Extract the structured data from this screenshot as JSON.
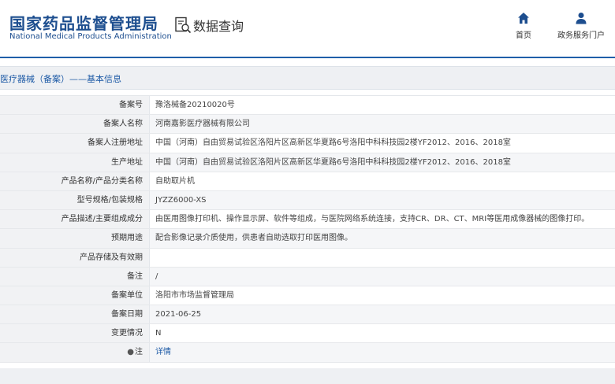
{
  "header": {
    "logo_cn": "国家药品监督管理局",
    "logo_en": "National Medical Products Administration",
    "query_label": "数据查询",
    "nav": [
      {
        "label": "首页",
        "icon": "home-icon"
      },
      {
        "label": "政务服务门户",
        "icon": "user-icon"
      }
    ]
  },
  "breadcrumb": "医疗器械（备案）——基本信息",
  "rows": [
    {
      "label": "备案号",
      "value": "豫洛械备20210020号"
    },
    {
      "label": "备案人名称",
      "value": "河南嘉影医疗器械有限公司"
    },
    {
      "label": "备案人注册地址",
      "value": "中国（河南）自由贸易试验区洛阳片区高新区华夏路6号洛阳中科科技园2楼YF2012、2016、2018室"
    },
    {
      "label": "生产地址",
      "value": "中国（河南）自由贸易试验区洛阳片区高新区华夏路6号洛阳中科科技园2楼YF2012、2016、2018室"
    },
    {
      "label": "产品名称/产品分类名称",
      "value": "自助取片机"
    },
    {
      "label": "型号规格/包装规格",
      "value": "JYZZ6000-XS"
    },
    {
      "label": "产品描述/主要组成成分",
      "value": "由医用图像打印机、操作显示屏、软件等组成，与医院网络系统连接，支持CR、DR、CT、MRI等医用成像器械的图像打印。"
    },
    {
      "label": "预期用途",
      "value": "配合影像记录介质使用，供患者自助选取打印医用图像。"
    },
    {
      "label": "产品存储及有效期",
      "value": ""
    },
    {
      "label": "备注",
      "value": "/"
    },
    {
      "label": "备案单位",
      "value": "洛阳市市场监督管理局"
    },
    {
      "label": "备案日期",
      "value": "2021-06-25"
    },
    {
      "label": "变更情况",
      "value": "N"
    }
  ],
  "note_row": {
    "pin": "●",
    "label": "注",
    "link": "详情"
  },
  "colors": {
    "brand": "#1d4e8f",
    "accent": "#1f5fa9",
    "link": "#1d5aa6"
  }
}
